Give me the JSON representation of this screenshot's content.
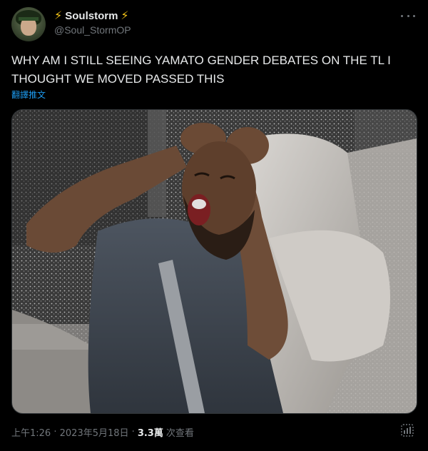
{
  "author": {
    "display_name": "Soulstorm",
    "name_decoration_icon": "lightning-bolt",
    "handle": "@Soul_StormOP",
    "avatar_icon": "anime-character-avatar"
  },
  "tweet": {
    "text": "WHY AM I STILL SEEING YAMATO GENDER DEBATES ON THE TL I THOUGHT WE MOVED PASSED THIS",
    "translate_label": "翻譯推文"
  },
  "media": {
    "kind": "photo",
    "subject": "man screaming in car with hands on head"
  },
  "meta": {
    "time": "上午1:26",
    "separator": "·",
    "date": "2023年5月18日",
    "views_count": "3.3萬",
    "views_label": "次查看"
  },
  "icons": {
    "more": "more-options-icon",
    "analytics": "analytics-icon"
  },
  "colors": {
    "background": "#000000",
    "text_primary": "#e7e9ea",
    "text_secondary": "#71767b",
    "link": "#1d9bf0",
    "bolt": "#f5c518"
  }
}
